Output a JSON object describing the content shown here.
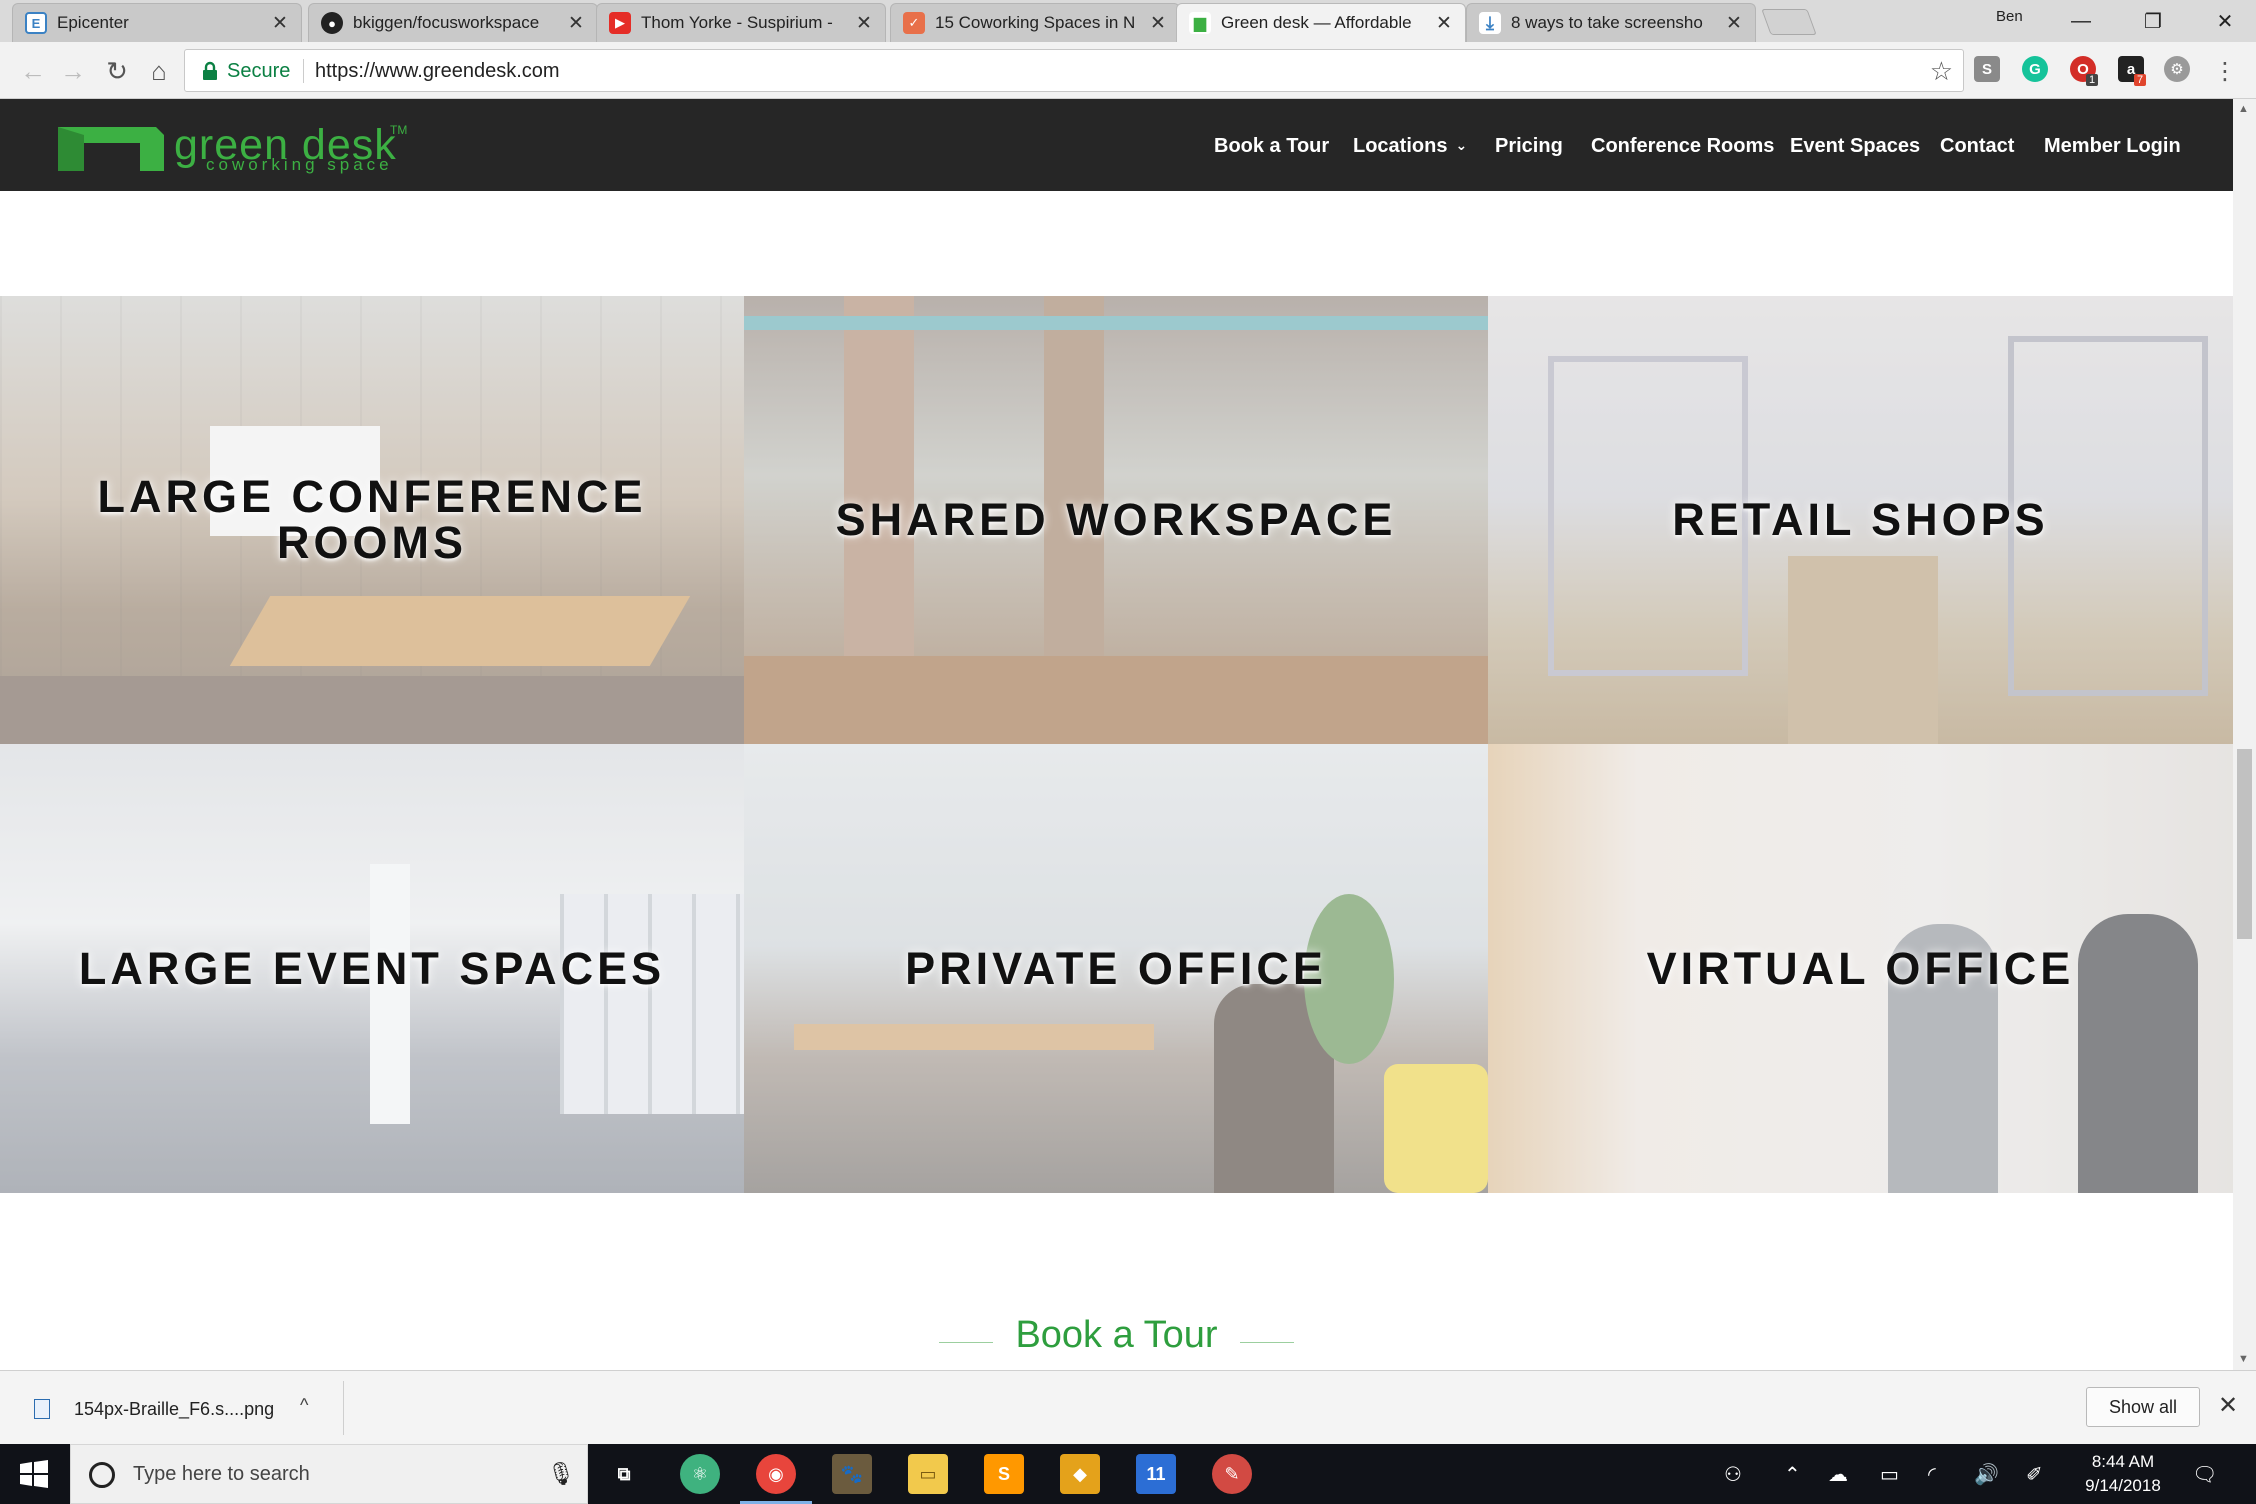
{
  "browser": {
    "tabs": [
      {
        "title": "Epicenter",
        "active": false
      },
      {
        "title": "bkiggen/focusworkspace",
        "active": false
      },
      {
        "title": "Thom Yorke - Suspirium -",
        "active": false
      },
      {
        "title": "15 Coworking Spaces in N",
        "active": false
      },
      {
        "title": "Green desk — Affordable",
        "active": true
      },
      {
        "title": "8 ways to take screensho",
        "active": false
      }
    ],
    "tab_close_glyph": "✕",
    "profile_name": "Ben",
    "window_controls": {
      "minimize": "—",
      "restore": "❐",
      "close": "✕"
    },
    "nav": {
      "back": "←",
      "forward": "→",
      "reload": "↻",
      "home": "⌂"
    },
    "secure_label": "Secure",
    "url": "https://www.greendesk.com",
    "bookmark_star": "☆",
    "menu_glyph": "⋮",
    "extensions": [
      {
        "name": "s-extension-icon",
        "glyph": "S",
        "color": "#8a8a8a"
      },
      {
        "name": "grammarly-icon",
        "glyph": "G",
        "color": "#15c39a"
      },
      {
        "name": "lastpass-icon",
        "glyph": "O",
        "color": "#d32d27",
        "badge": "1"
      },
      {
        "name": "amazon-icon",
        "glyph": "a",
        "color": "#222222",
        "badge": "7"
      },
      {
        "name": "settings-extension-icon",
        "glyph": "⚙",
        "color": "#9a9a9a"
      }
    ]
  },
  "site": {
    "brand": {
      "word": "green desk",
      "tm": "TM",
      "tagline": "coworking space",
      "color": "#3cb043"
    },
    "menu": [
      {
        "label": "Book a Tour"
      },
      {
        "label": "Locations",
        "caret": "⌄"
      },
      {
        "label": "Pricing"
      },
      {
        "label": "Conference Rooms"
      },
      {
        "label": "Event Spaces"
      },
      {
        "label": "Contact"
      },
      {
        "label": "Member Login"
      }
    ],
    "tiles": [
      {
        "label": "LARGE CONFERENCE ROOMS"
      },
      {
        "label": "SHARED WORKSPACE"
      },
      {
        "label": "RETAIL SHOPS"
      },
      {
        "label": "LARGE EVENT SPACES"
      },
      {
        "label": "PRIVATE OFFICE"
      },
      {
        "label": "VIRTUAL OFFICE"
      }
    ],
    "book_tour_heading": "Book a Tour"
  },
  "download_bar": {
    "file_name": "154px-Braille_F6.s....png",
    "expand_glyph": "^",
    "show_all": "Show all",
    "close_glyph": "✕"
  },
  "taskbar": {
    "search_placeholder": "Type here to search",
    "apps": [
      {
        "name": "task-view-icon",
        "glyph": "⧉",
        "color": "#101218"
      },
      {
        "name": "atom-app-icon",
        "glyph": "⚛",
        "color": "#3fb27f"
      },
      {
        "name": "chrome-app-icon",
        "glyph": "◉",
        "color": "#e8453c"
      },
      {
        "name": "gimp-app-icon",
        "glyph": "🐾",
        "color": "#6b5b3e"
      },
      {
        "name": "file-explorer-icon",
        "glyph": "▭",
        "color": "#f2c94c"
      },
      {
        "name": "sublime-app-icon",
        "glyph": "S",
        "color": "#ff9800"
      },
      {
        "name": "sketch-app-icon",
        "glyph": "◆",
        "color": "#e4a21b"
      },
      {
        "name": "calendar-app-icon",
        "glyph": "11",
        "color": "#2c6ed5"
      },
      {
        "name": "paint-app-icon",
        "glyph": "✎",
        "color": "#d24a43"
      }
    ],
    "clock_time": "8:44 AM",
    "clock_date": "9/14/2018"
  }
}
